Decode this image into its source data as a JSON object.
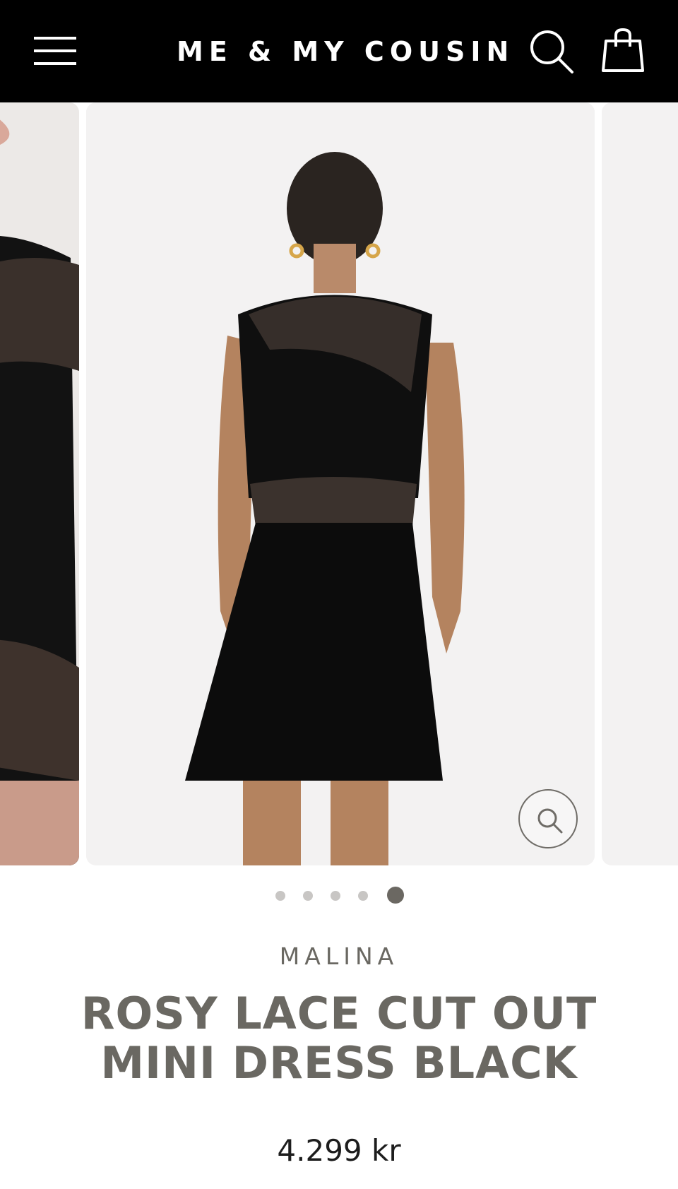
{
  "header": {
    "brand": "ME & MY COUSIN",
    "icons": [
      "menu-icon",
      "search-icon",
      "shopping-bag-icon"
    ],
    "background": "#000000"
  },
  "gallery": {
    "slide_count": 5,
    "active_slide": 5,
    "zoom_icon": "zoom-icon"
  },
  "product": {
    "brand": "MALINA",
    "title_line1": "ROSY LACE CUT OUT",
    "title_line2": "MINI DRESS BLACK",
    "price": "4.299 kr"
  },
  "colors": {
    "text_muted": "#6a6862",
    "price_text": "#1d1d1d",
    "image_background": "#f3f2f2",
    "dot_inactive": "#c8c6c4",
    "dot_active": "#6b6862"
  }
}
